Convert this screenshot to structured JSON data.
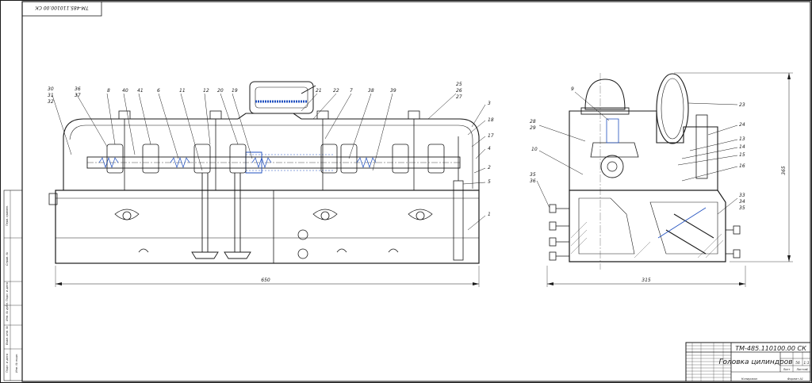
{
  "sheet": {
    "top_code": "ТМ-485.110100.00 СК",
    "left_strip": [
      "Перв. примен.",
      "Справ. №",
      "Подп. и дата",
      "Инв. № дубл.",
      "Взам. инв. №",
      "Подп. и дата",
      "Инв. № подл."
    ]
  },
  "front_view": {
    "labels": [
      {
        "id": "30",
        "text": "30"
      },
      {
        "id": "31",
        "text": "31"
      },
      {
        "id": "32",
        "text": "32"
      },
      {
        "id": "36",
        "text": "36"
      },
      {
        "id": "37",
        "text": "37"
      },
      {
        "id": "8",
        "text": "8"
      },
      {
        "id": "40",
        "text": "40"
      },
      {
        "id": "41",
        "text": "41"
      },
      {
        "id": "6",
        "text": "6"
      },
      {
        "id": "11",
        "text": "11"
      },
      {
        "id": "12",
        "text": "12"
      },
      {
        "id": "20",
        "text": "20"
      },
      {
        "id": "19",
        "text": "19"
      },
      {
        "id": "21",
        "text": "21"
      },
      {
        "id": "22",
        "text": "22"
      },
      {
        "id": "7",
        "text": "7"
      },
      {
        "id": "38",
        "text": "38"
      },
      {
        "id": "39",
        "text": "39"
      },
      {
        "id": "25",
        "text": "25"
      },
      {
        "id": "26",
        "text": "26"
      },
      {
        "id": "27",
        "text": "27"
      },
      {
        "id": "3",
        "text": "3"
      },
      {
        "id": "18",
        "text": "18"
      },
      {
        "id": "17",
        "text": "17"
      },
      {
        "id": "4",
        "text": "4"
      },
      {
        "id": "2",
        "text": "2"
      },
      {
        "id": "5",
        "text": "5"
      },
      {
        "id": "1",
        "text": "1"
      }
    ],
    "dimension": "650"
  },
  "side_view": {
    "labels": [
      {
        "id": "9",
        "text": "9"
      },
      {
        "id": "28",
        "text": "28"
      },
      {
        "id": "29",
        "text": "29"
      },
      {
        "id": "10",
        "text": "10"
      },
      {
        "id": "35",
        "text": "35"
      },
      {
        "id": "36",
        "text": "36"
      },
      {
        "id": "23",
        "text": "23"
      },
      {
        "id": "24",
        "text": "24"
      },
      {
        "id": "13",
        "text": "13"
      },
      {
        "id": "14",
        "text": "14"
      },
      {
        "id": "15",
        "text": "15"
      },
      {
        "id": "16",
        "text": "16"
      },
      {
        "id": "33",
        "text": "33"
      },
      {
        "id": "34",
        "text": "34"
      },
      {
        "id": "35b",
        "text": "35"
      }
    ],
    "dimension_width": "315",
    "dimension_height": "365"
  },
  "title_block": {
    "code": "ТМ-485.110100.00 СК",
    "title": "Головка цилиндров",
    "sheet_label": "Лист",
    "sheets_label": "Листов",
    "mass_value": "56",
    "scale_value": "1:1",
    "sheet_no": "1",
    "copied_label": "Копировал",
    "format_label": "Формат  А1"
  },
  "colors": {
    "ink": "#1a1a1a",
    "accent": "#1f4fbf"
  }
}
